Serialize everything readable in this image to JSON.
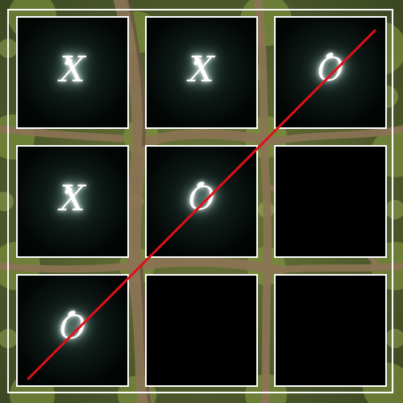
{
  "board": {
    "cells": [
      {
        "mark": "X"
      },
      {
        "mark": "X"
      },
      {
        "mark": "O"
      },
      {
        "mark": "X"
      },
      {
        "mark": "O"
      },
      {
        "mark": ""
      },
      {
        "mark": "O"
      },
      {
        "mark": ""
      },
      {
        "mark": ""
      }
    ],
    "winning_cells": [
      2,
      4,
      6
    ],
    "win_line_color": "#e0101a",
    "grid_color": "#ffffff",
    "mark_glow_color": "#ffffff"
  }
}
